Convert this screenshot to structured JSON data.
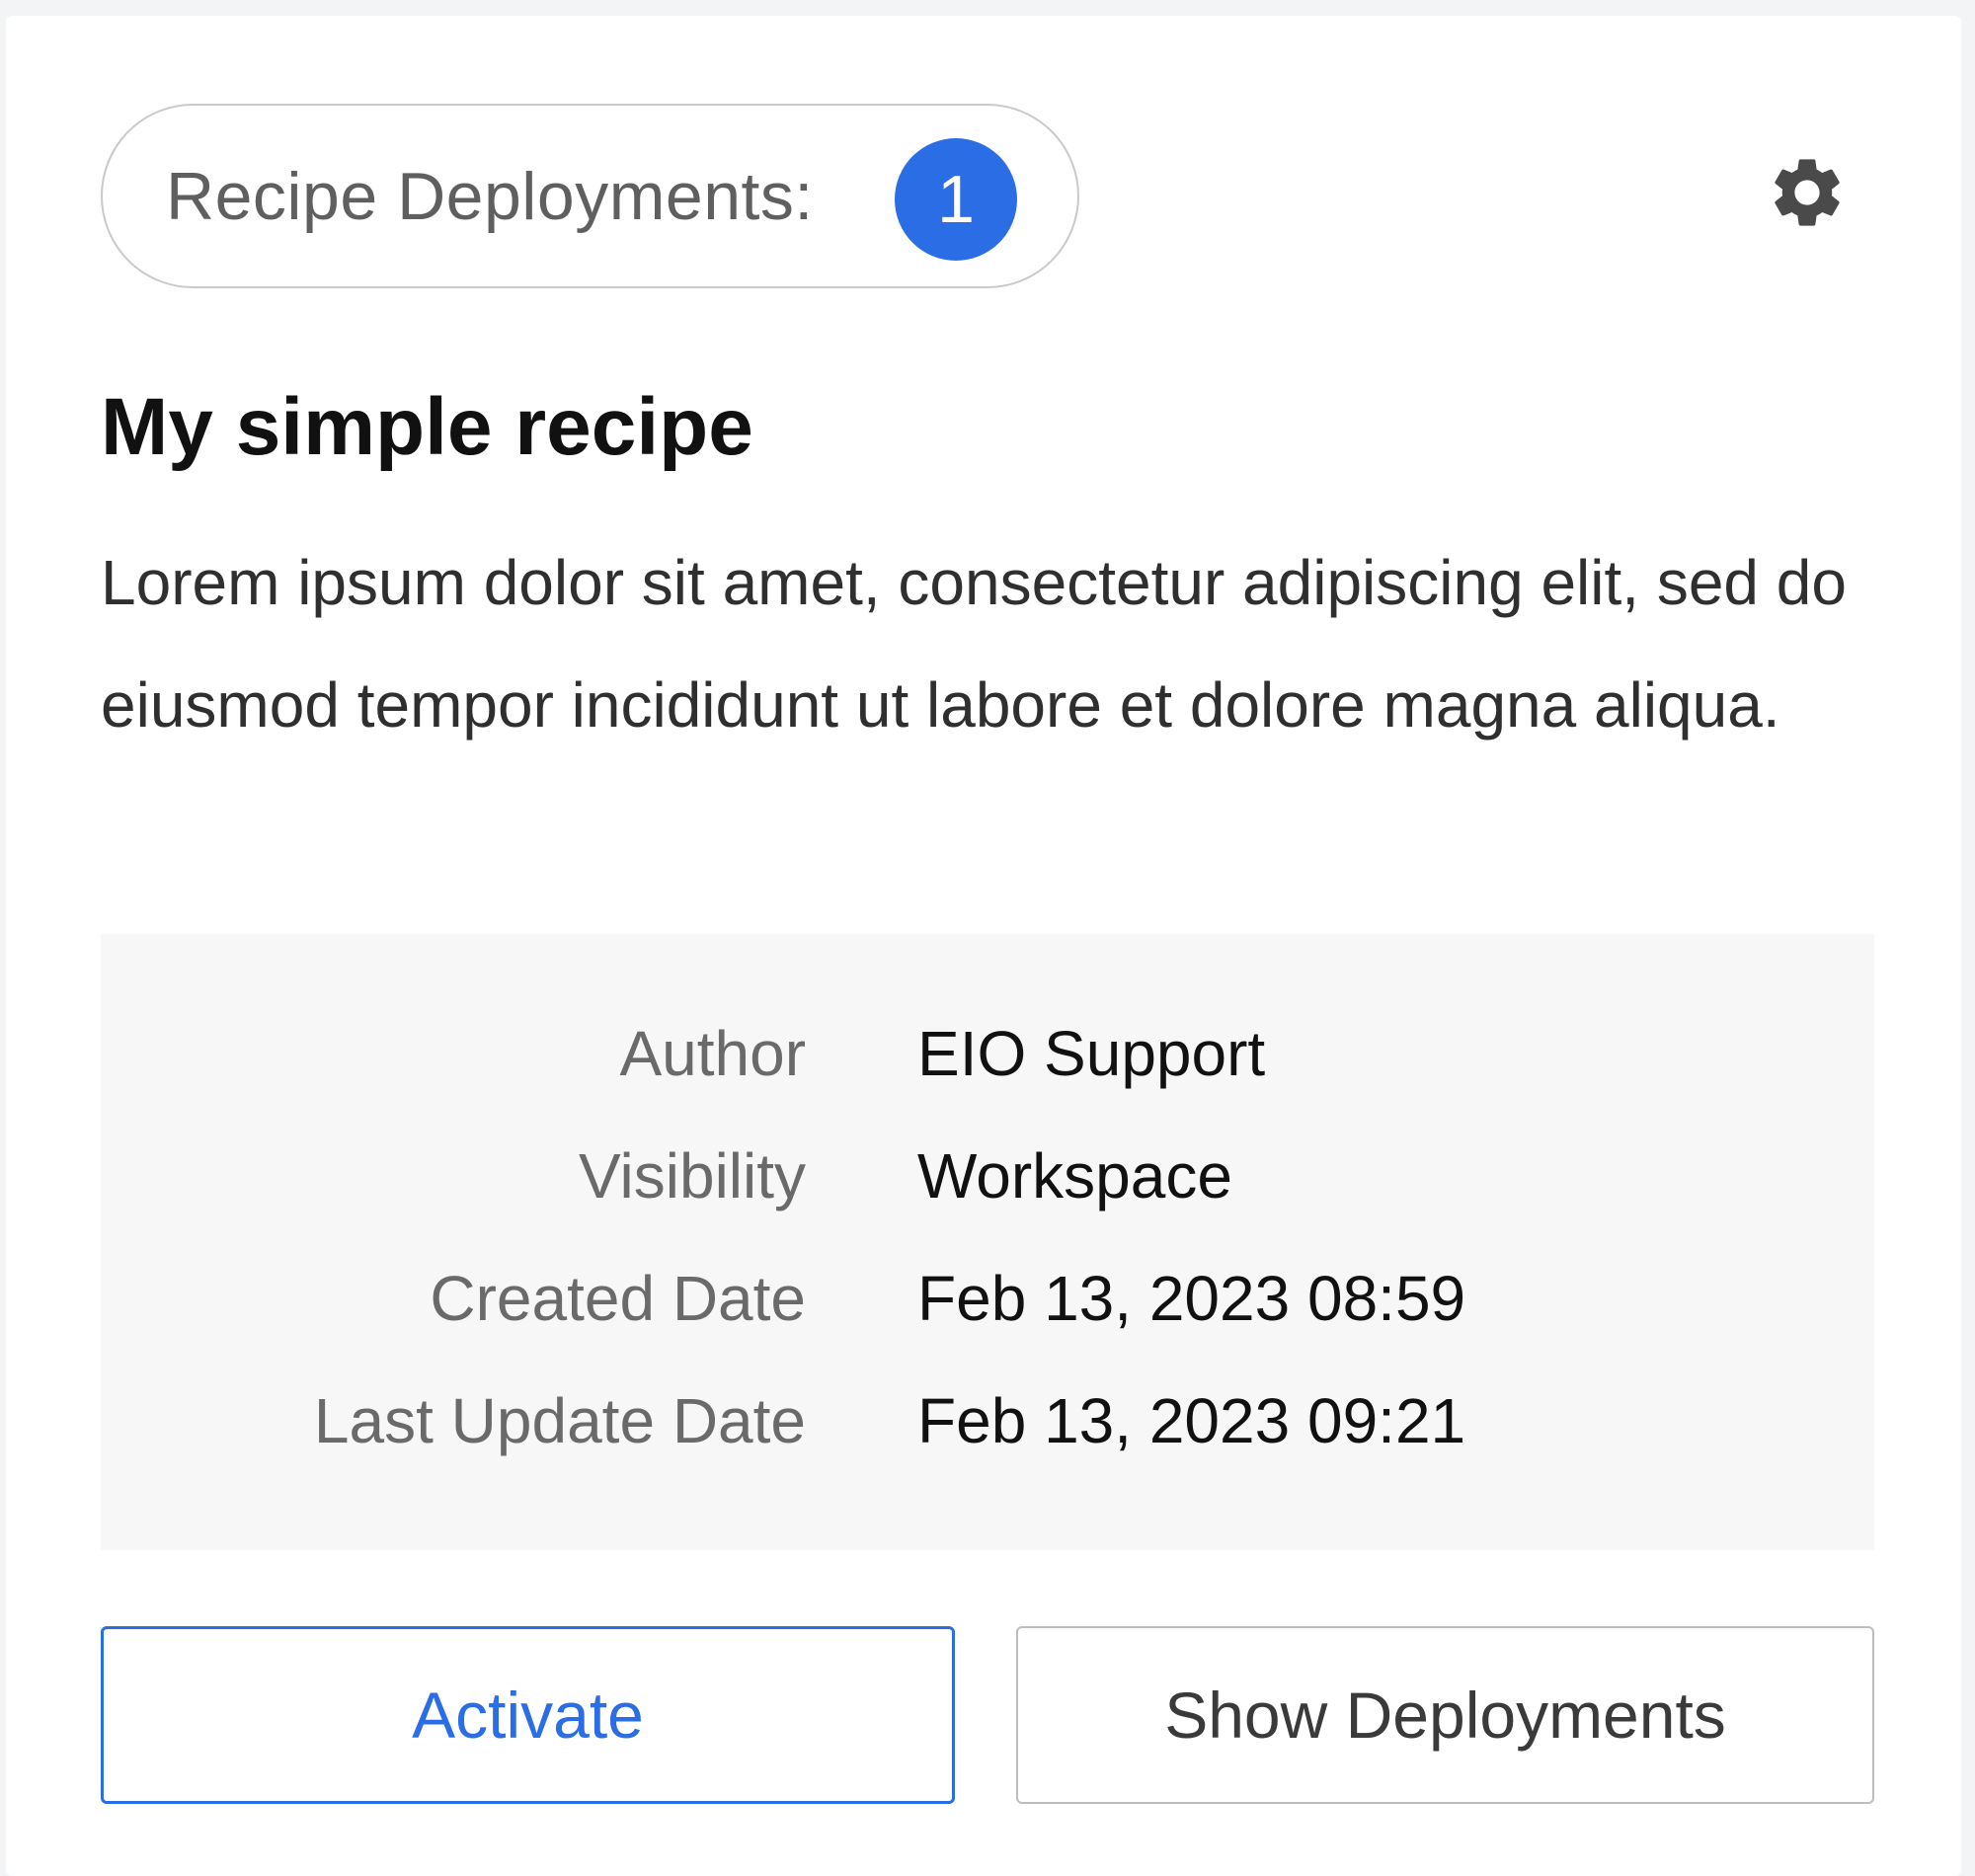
{
  "deployments": {
    "label": "Recipe Deployments:",
    "count": "1"
  },
  "icons": {
    "settings": "gear-icon"
  },
  "colors": {
    "accent": "#2b6de5",
    "metaBackground": "#f7f7f7"
  },
  "recipe": {
    "title": "My simple recipe",
    "description": "Lorem ipsum dolor sit amet, consectetur adipiscing elit, sed do eiusmod tempor incididunt ut labore et dolore magna aliqua."
  },
  "meta": {
    "author_label": "Author",
    "author_value": "EIO Support",
    "visibility_label": "Visibility",
    "visibility_value": "Workspace",
    "created_label": "Created Date",
    "created_value": "Feb 13, 2023 08:59",
    "updated_label": "Last Update Date",
    "updated_value": "Feb 13, 2023 09:21"
  },
  "actions": {
    "activate_label": "Activate",
    "show_deployments_label": "Show Deployments"
  }
}
